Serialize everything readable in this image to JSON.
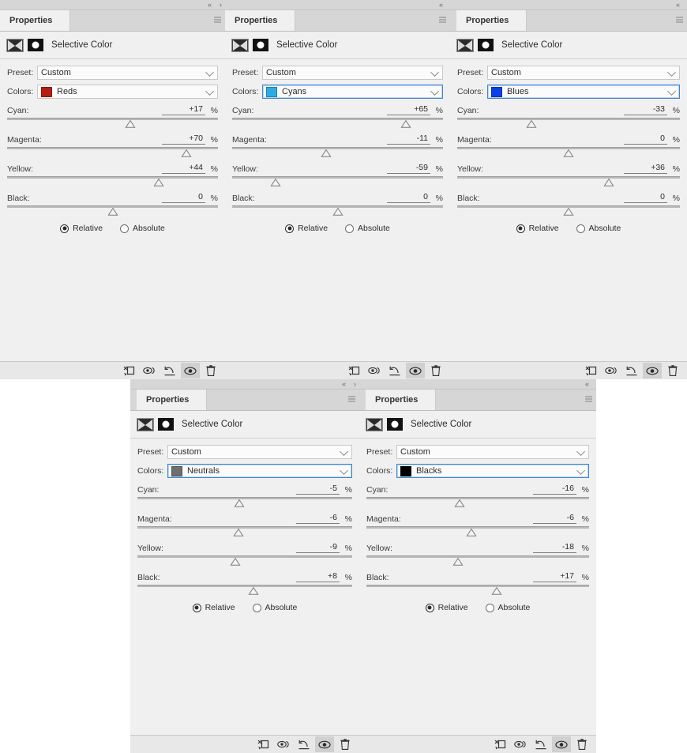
{
  "app": {
    "panel_tab_label": "Properties",
    "adjustment_title": "Selective Color",
    "preset_label": "Preset:",
    "preset_value": "Custom",
    "colors_label": "Colors:",
    "percent_sign": "%",
    "channel_labels": {
      "cyan": "Cyan:",
      "magenta": "Magenta:",
      "yellow": "Yellow:",
      "black": "Black:"
    },
    "method": {
      "relative": "Relative",
      "absolute": "Absolute"
    },
    "collapse_icon": "«",
    "expand_icon": "›",
    "icons": {
      "adjustment": "selective-color-icon",
      "mask": "layer-mask-icon",
      "clip": "clip-to-layer-icon",
      "preview_previous": "view-previous-state-icon",
      "reset": "reset-icon",
      "visibility": "toggle-visibility-icon",
      "delete": "delete-layer-icon"
    }
  },
  "panels": [
    {
      "id": "reds",
      "color_name": "Reds",
      "swatch": "#b41f12",
      "colors_focused": false,
      "cyan": "+17",
      "magenta": "+70",
      "yellow": "+44",
      "black": "0",
      "cyan_num": 17,
      "magenta_num": 70,
      "yellow_num": 44,
      "black_num": 0,
      "method_selected": "Relative"
    },
    {
      "id": "cyans",
      "color_name": "Cyans",
      "swatch": "#2bade4",
      "colors_focused": true,
      "cyan": "+65",
      "magenta": "-11",
      "yellow": "-59",
      "black": "0",
      "cyan_num": 65,
      "magenta_num": -11,
      "yellow_num": -59,
      "black_num": 0,
      "method_selected": "Relative"
    },
    {
      "id": "blues",
      "color_name": "Blues",
      "swatch": "#0b3fe8",
      "colors_focused": true,
      "cyan": "-33",
      "magenta": "0",
      "yellow": "+36",
      "black": "0",
      "cyan_num": -33,
      "magenta_num": 0,
      "yellow_num": 36,
      "black_num": 0,
      "method_selected": "Relative"
    },
    {
      "id": "neutrals",
      "color_name": "Neutrals",
      "swatch": "#6e6e6e",
      "colors_focused": true,
      "cyan": "-5",
      "magenta": "-6",
      "yellow": "-9",
      "black": "+8",
      "cyan_num": -5,
      "magenta_num": -6,
      "yellow_num": -9,
      "black_num": 8,
      "method_selected": "Relative"
    },
    {
      "id": "blacks",
      "color_name": "Blacks",
      "swatch": "#000000",
      "colors_focused": true,
      "cyan": "-16",
      "magenta": "-6",
      "yellow": "-18",
      "black": "+17",
      "cyan_num": -16,
      "magenta_num": -6,
      "yellow_num": -18,
      "black_num": 17,
      "method_selected": "Relative"
    }
  ]
}
